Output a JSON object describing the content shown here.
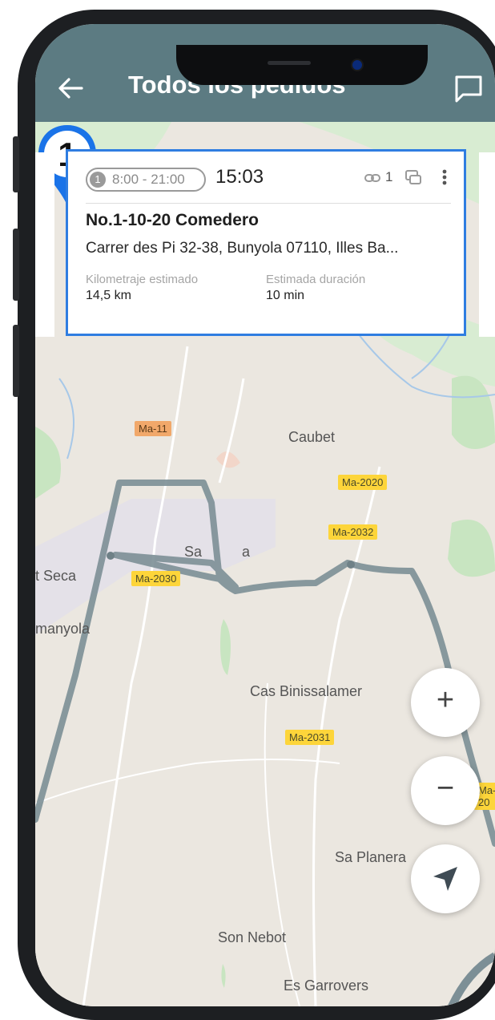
{
  "app_bar": {
    "title": "Todos los pedidos",
    "back_icon": "arrow-left-icon",
    "chat_icon": "chat-bubble-icon"
  },
  "order_card": {
    "sequence": "1",
    "time_window": "8:00 - 21:00",
    "eta": "15:03",
    "links_count": "1",
    "name": "No.1-10-20 Comedero",
    "address": "Carrer des Pi 32-38, Bunyola 07110, Illes Ba...",
    "distance_label": "Kilometraje estimado",
    "distance_value": "14,5  km",
    "duration_label": "Estimada duración",
    "duration_value": "10 min"
  },
  "map": {
    "pin_number": "1",
    "places": [
      "Caubet",
      "Sa",
      "a",
      "t Seca",
      "manyola",
      "Cas Binissalamer",
      "Sa Planera",
      "Son Nebot",
      "Es Garrovers"
    ],
    "roads": [
      "Ma-11",
      "Ma-2020",
      "Ma-2032",
      "Ma-2030",
      "Ma-2031",
      "Ma-20"
    ],
    "route_color": "#7c8f96",
    "pin_color": "#1a73e8"
  },
  "controls": {
    "zoom_in": "+",
    "zoom_out": "−"
  }
}
